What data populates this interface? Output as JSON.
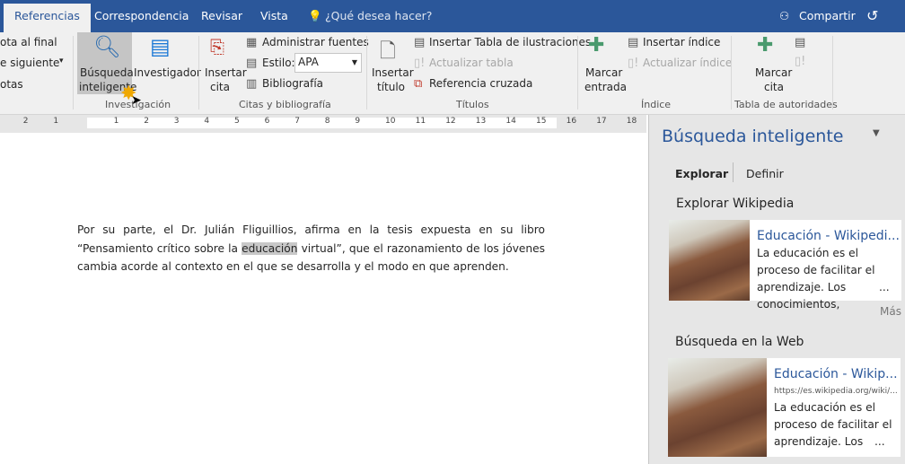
{
  "tabs": [
    {
      "label": "Referencias",
      "active": true
    },
    {
      "label": "Correspondencia"
    },
    {
      "label": "Revisar"
    },
    {
      "label": "Vista"
    }
  ],
  "tell_me": "¿Qué desea hacer?",
  "share": "Compartir",
  "ribbon": {
    "notes": {
      "insert_endnote": "ota al final",
      "next_note": "e siguiente",
      "show_notes": "otas"
    },
    "research": {
      "smart_lookup_1": "Búsqueda",
      "smart_lookup_2": "inteligente",
      "researcher": "Investigador",
      "group": "Investigación"
    },
    "citations": {
      "insert_citation_1": "Insertar",
      "insert_citation_2": "cita",
      "manage_sources": "Administrar fuentes",
      "style_label": "Estilo:",
      "style_value": "APA",
      "bibliography": "Bibliografía",
      "group": "Citas y bibliografía"
    },
    "captions": {
      "insert_caption_1": "Insertar",
      "insert_caption_2": "título",
      "insert_table_figures": "Insertar Tabla de ilustraciones",
      "update_table": "Actualizar tabla",
      "cross_reference": "Referencia cruzada",
      "group": "Títulos"
    },
    "index": {
      "mark_entry_1": "Marcar",
      "mark_entry_2": "entrada",
      "insert_index": "Insertar índice",
      "update_index": "Actualizar índice",
      "group": "Índice"
    },
    "authorities": {
      "mark_citation_1": "Marcar",
      "mark_citation_2": "cita",
      "group": "Tabla de autoridades"
    }
  },
  "ruler": [
    "2",
    "1",
    "1",
    "2",
    "3",
    "4",
    "5",
    "6",
    "7",
    "8",
    "9",
    "10",
    "11",
    "12",
    "13",
    "14",
    "15",
    "16",
    "17",
    "18"
  ],
  "document": {
    "before": "Por su parte, el Dr. Julián Fliguillios, afirma en la tesis expuesta en su libro “Pensamiento crítico sobre la ",
    "highlight": "educación",
    "after": " virtual”, que el razonamiento de los jóvenes cambia acorde al contexto en el que se desarrolla y el modo en que aprenden."
  },
  "panel": {
    "title": "Búsqueda inteligente",
    "tabs": [
      "Explorar",
      "Definir"
    ],
    "wiki_heading": "Explorar Wikipedia",
    "wiki_card": {
      "title": "Educación - Wikipedi...",
      "text": "La educación es el proceso de facilitar el aprendizaje. Los conocimientos,",
      "more": "..."
    },
    "more_link": "Más",
    "web_heading": "Búsqueda en la Web",
    "web_card": {
      "title": "Educación - Wikip...",
      "url": "https://es.wikipedia.org/wiki/...",
      "text": "La educación es el proceso de facilitar el aprendizaje. Los",
      "more": "..."
    }
  },
  "colors": {
    "brand": "#2b579a",
    "panel_bg": "#e6e6e6"
  }
}
